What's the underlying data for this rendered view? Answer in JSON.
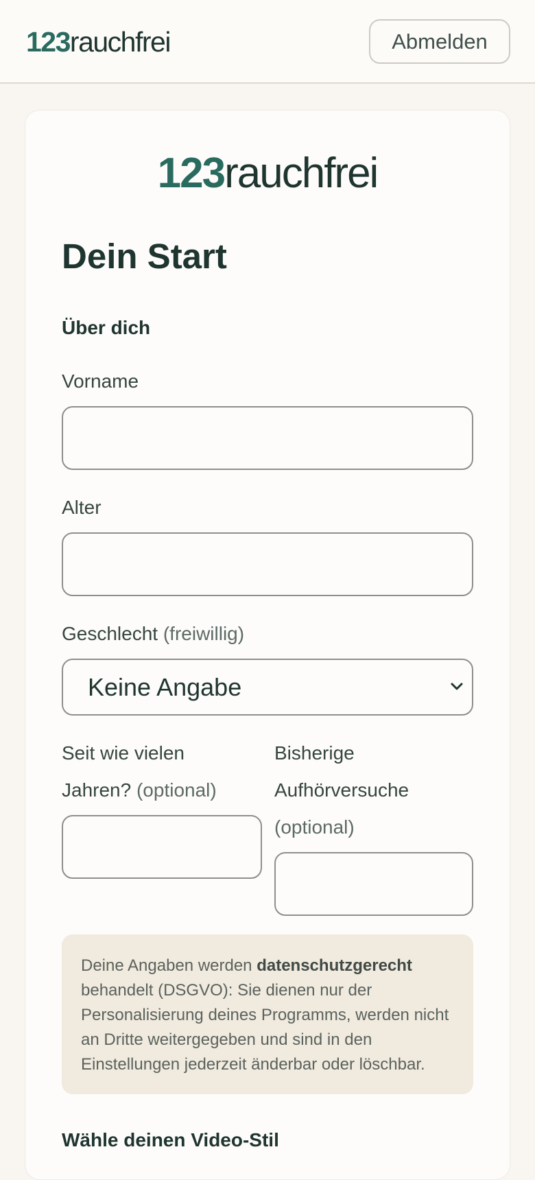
{
  "header": {
    "brand_number": "123",
    "brand_word": "rauchfrei",
    "logout_label": "Abmelden"
  },
  "card": {
    "brand_number": "123",
    "brand_word": "rauchfrei",
    "title": "Dein Start",
    "section_about": "Über dich",
    "fields": {
      "firstname": {
        "label": "Vorname",
        "value": ""
      },
      "age": {
        "label": "Alter",
        "value": ""
      },
      "gender": {
        "label": "Geschlecht",
        "hint": "(freiwillig)",
        "selected": "Keine Angabe"
      },
      "years": {
        "label_line1": "Seit wie vielen",
        "label_line2": "Jahren?",
        "hint": "(optional)",
        "value": ""
      },
      "attempts": {
        "label_line1": "Bisherige",
        "label_line2": "Aufhörversuche",
        "hint": "(optional)",
        "value": ""
      }
    },
    "privacy_note": {
      "before": "Deine Angaben werden ",
      "bold": "datenschutzgerecht",
      "after": " behandelt (DSGVO): Sie dienen nur der Personalisierung deines Programms, werden nicht an Dritte weitergegeben und sind in den Einstellungen jederzeit änderbar oder löschbar."
    },
    "section_video": "Wähle deinen Video-Stil"
  },
  "colors": {
    "brand_green": "#2a6b5f",
    "text_dark": "#1f3530",
    "note_background": "#f1eade",
    "page_background": "#f9f6f1"
  },
  "icons": {
    "select_arrow": "chevron-down-icon"
  }
}
